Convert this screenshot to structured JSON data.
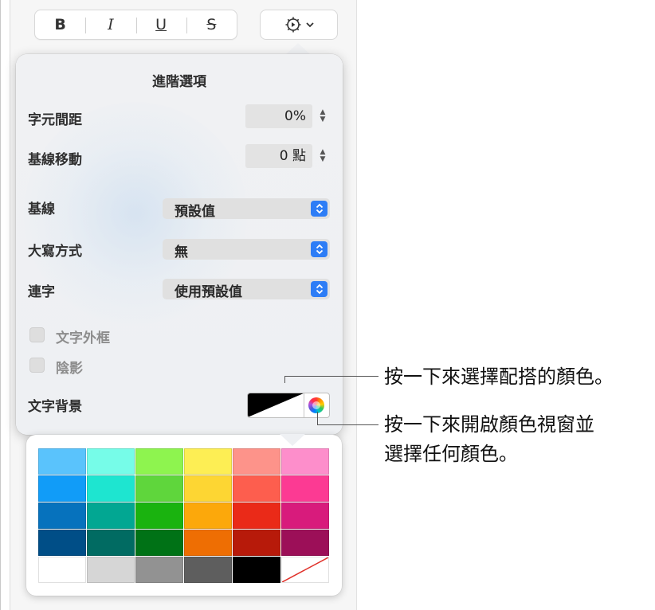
{
  "format_bar": {
    "bold": "B",
    "italic": "I",
    "underline": "U",
    "strikethrough": "S"
  },
  "gear_menu": {
    "icon": "gear-icon",
    "chevron": "chevron-down-icon"
  },
  "popover": {
    "title": "進階選項",
    "character_spacing": {
      "label": "字元間距",
      "value": "0%"
    },
    "baseline_shift": {
      "label": "基線移動",
      "value": "0 點"
    },
    "baseline": {
      "label": "基線",
      "value": "預設值"
    },
    "capitalization": {
      "label": "大寫方式",
      "value": "無"
    },
    "ligatures": {
      "label": "連字",
      "value": "使用預設值"
    },
    "outline": {
      "label": "文字外框"
    },
    "shadow": {
      "label": "陰影"
    },
    "text_background": {
      "label": "文字背景"
    }
  },
  "palette": {
    "rows": [
      [
        "#5ac3fc",
        "#76fce8",
        "#8ef44f",
        "#fdee54",
        "#fd938a",
        "#fd8ecb"
      ],
      [
        "#119cf8",
        "#1ee5d0",
        "#5fd63c",
        "#fdd633",
        "#fd5e4e",
        "#fc3a93"
      ],
      [
        "#0672bd",
        "#02a792",
        "#1ab30f",
        "#fca80b",
        "#ea2a18",
        "#d81b7c"
      ],
      [
        "#004e87",
        "#016b62",
        "#007216",
        "#ee6e03",
        "#b71a0a",
        "#9c0f58"
      ],
      [
        "#ffffff",
        "#d6d6d6",
        "#929292",
        "#5e5e5e",
        "#000000",
        "none"
      ]
    ]
  },
  "callouts": {
    "swatch_hint": "按一下來選擇配搭的顏色。",
    "wheel_hint_line1": "按一下來開啟顏色視窗並",
    "wheel_hint_line2": "選擇任何顏色。"
  }
}
